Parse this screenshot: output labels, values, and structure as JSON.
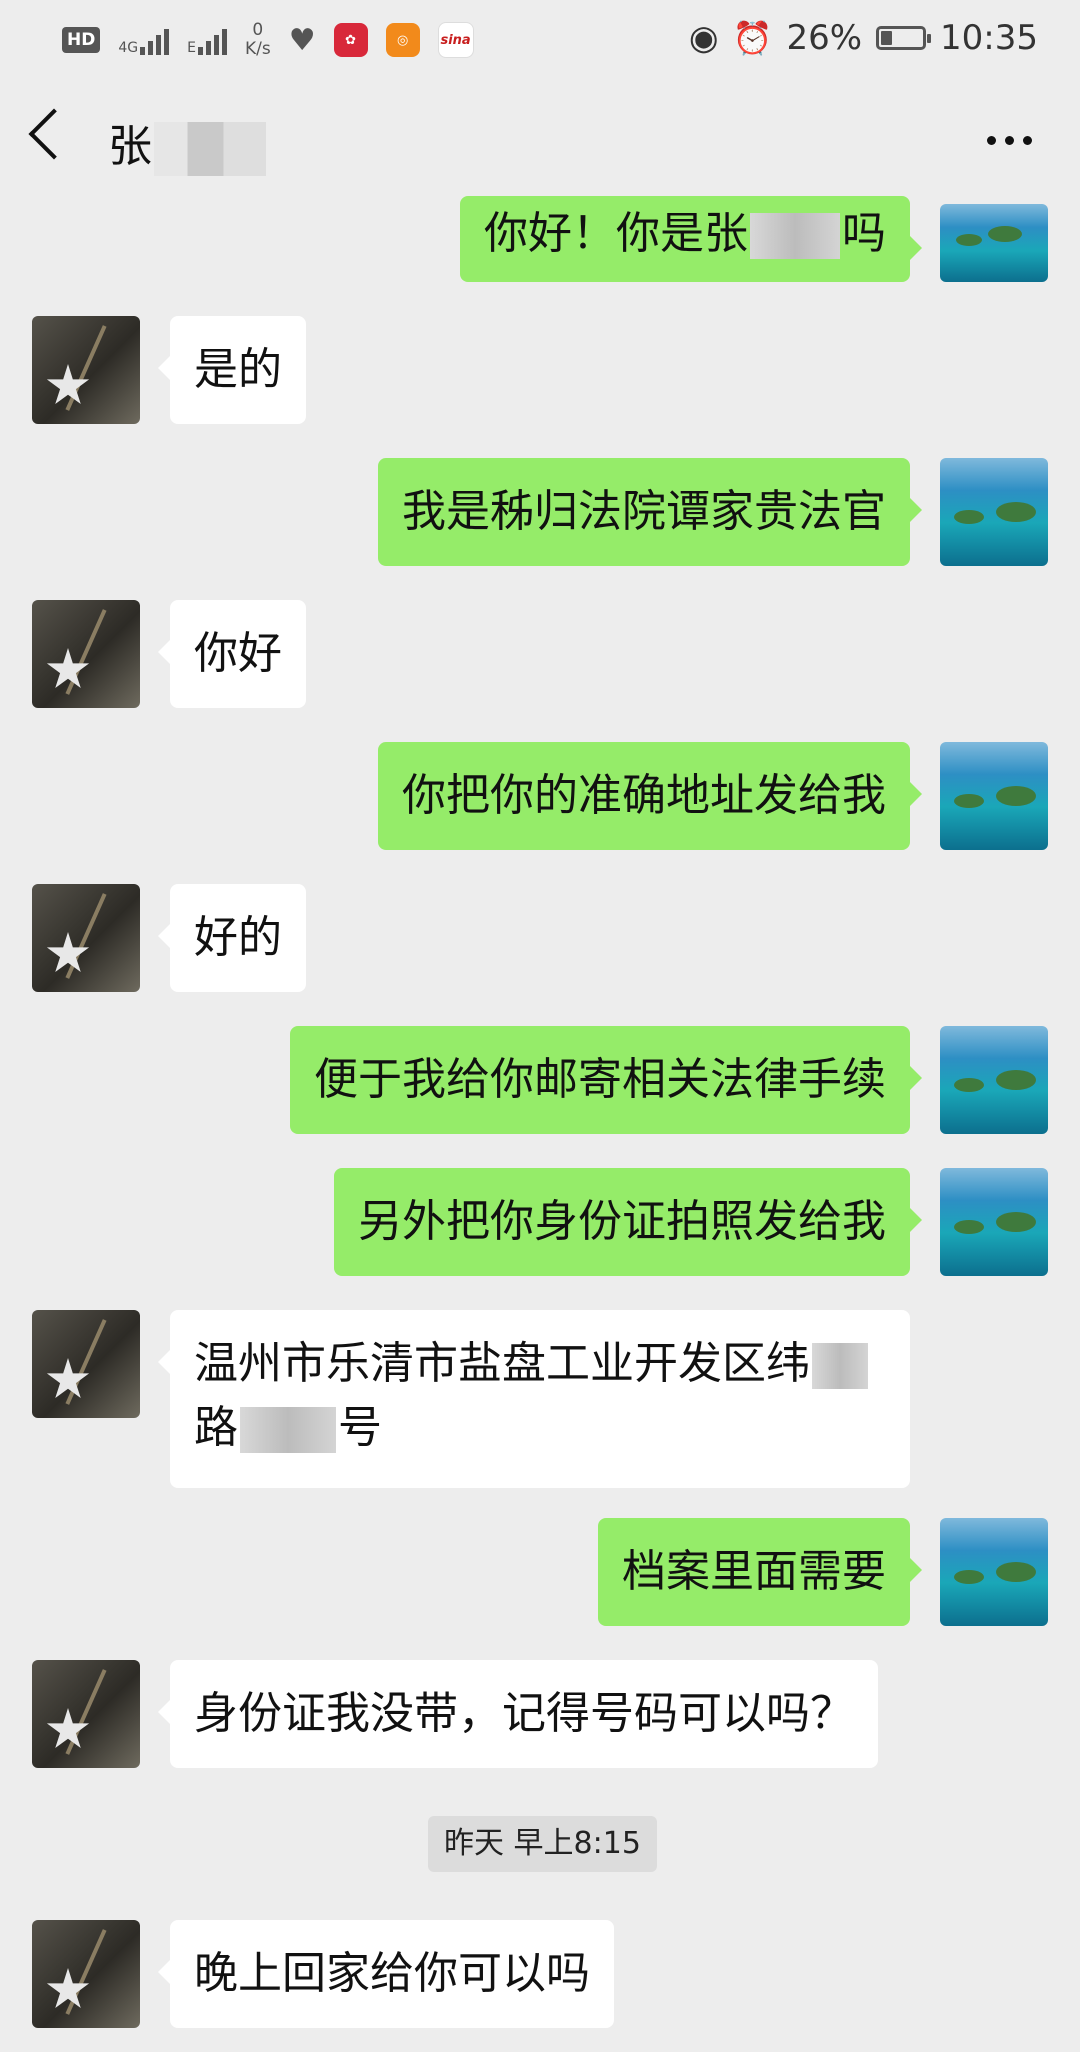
{
  "status_bar": {
    "hd": "HD",
    "network": "4G",
    "network2": "E",
    "speed_value": "0",
    "speed_unit": "K/s",
    "battery": "26%",
    "time": "10:35"
  },
  "header": {
    "contact_name_visible": "张",
    "more_icon": "ellipsis-icon",
    "back_icon": "chevron-left-icon"
  },
  "messages": [
    {
      "side": "out",
      "text_a": "你好！你是张",
      "text_b": "吗"
    },
    {
      "side": "in",
      "text": "是的"
    },
    {
      "side": "out",
      "text": "我是秭归法院谭家贵法官"
    },
    {
      "side": "in",
      "text": "你好"
    },
    {
      "side": "out",
      "text": "你把你的准确地址发给我"
    },
    {
      "side": "in",
      "text": "好的"
    },
    {
      "side": "out",
      "text": "便于我给你邮寄相关法律手续"
    },
    {
      "side": "out",
      "text": "另外把你身份证拍照发给我"
    },
    {
      "side": "in",
      "line1": "温州市乐清市盐盘工业开发区纬",
      "line2a": "路",
      "line2b": "号"
    },
    {
      "side": "out",
      "text": "档案里面需要"
    },
    {
      "side": "in",
      "text": "身份证我没带，记得号码可以吗？"
    },
    {
      "side": "in",
      "text": "晚上回家给你可以吗"
    }
  ],
  "timestamp": "昨天 早上8:15",
  "colors": {
    "outgoing": "#95ec69",
    "incoming": "#ffffff",
    "background": "#ededed"
  }
}
